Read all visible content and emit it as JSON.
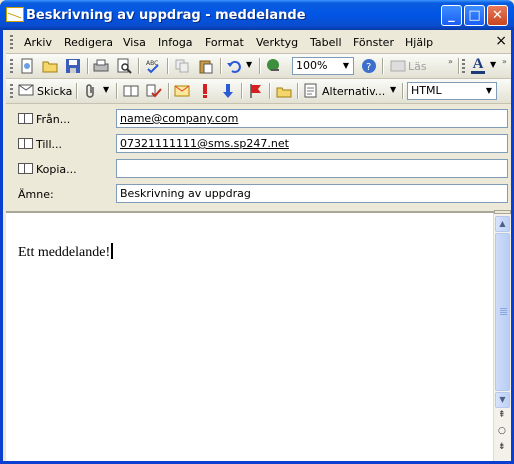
{
  "window": {
    "title": "Beskrivning av uppdrag - meddelande"
  },
  "menubar": {
    "items": [
      "Arkiv",
      "Redigera",
      "Visa",
      "Infoga",
      "Format",
      "Verktyg",
      "Tabell",
      "Fönster",
      "Hjälp"
    ],
    "close_glyph": "×"
  },
  "standard_toolbar": {
    "zoom_value": "100%",
    "read_label": "Läs"
  },
  "mail_toolbar": {
    "send_label": "Skicka",
    "options_label": "Alternativ...",
    "format_value": "HTML"
  },
  "header": {
    "from_label": "Från...",
    "from_value": "name@company.com",
    "to_label": "Till...",
    "to_value": "07321111111@sms.sp247.net",
    "cc_label": "Kopia...",
    "cc_value": "",
    "subject_label": "Ämne:",
    "subject_value": "Beskrivning av uppdrag"
  },
  "body": {
    "text": "Ett meddelande!"
  },
  "colors": {
    "titlebar": "#0055e5",
    "chrome": "#ece9d8"
  }
}
